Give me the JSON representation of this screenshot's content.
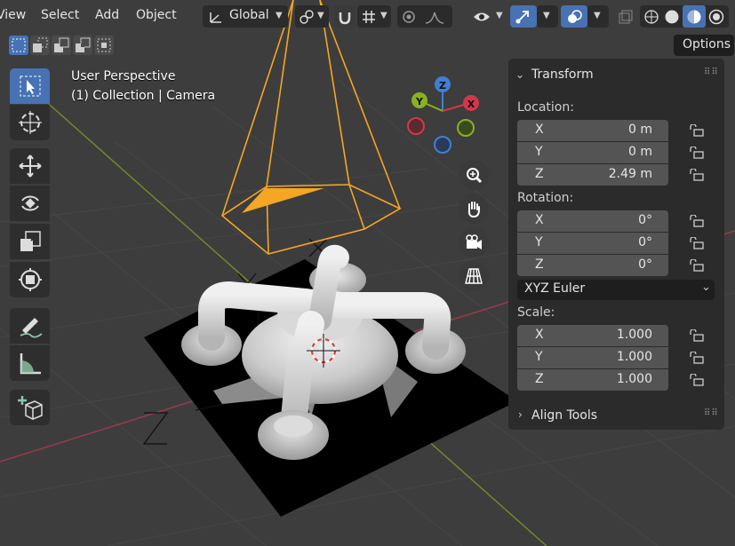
{
  "menu": {
    "view": "View",
    "select": "Select",
    "add": "Add",
    "object": "Object"
  },
  "header": {
    "orientation": "Global",
    "options_label": "Options"
  },
  "overlay": {
    "line1": "User Perspective",
    "line2": "(1) Collection | Camera"
  },
  "gizmo": {
    "x": "X",
    "y": "Y",
    "z": "Z"
  },
  "empty_labels": {
    "x": "X",
    "y": "Y",
    "z": "Z"
  },
  "panel": {
    "transform_title": "Transform",
    "location_label": "Location:",
    "location": [
      {
        "axis": "X",
        "value": "0 m"
      },
      {
        "axis": "Y",
        "value": "0 m"
      },
      {
        "axis": "Z",
        "value": "2.49 m"
      }
    ],
    "rotation_label": "Rotation:",
    "rotation": [
      {
        "axis": "X",
        "value": "0°"
      },
      {
        "axis": "Y",
        "value": "0°"
      },
      {
        "axis": "Z",
        "value": "0°"
      }
    ],
    "rotation_mode": "XYZ Euler",
    "scale_label": "Scale:",
    "scale": [
      {
        "axis": "X",
        "value": "1.000"
      },
      {
        "axis": "Y",
        "value": "1.000"
      },
      {
        "axis": "Z",
        "value": "1.000"
      }
    ],
    "align_title": "Align Tools"
  },
  "colors": {
    "accent": "#4772b3",
    "camera": "#f5a623",
    "axis_x": "#d4374a",
    "axis_y": "#8ab023",
    "axis_z": "#3d80d6"
  }
}
